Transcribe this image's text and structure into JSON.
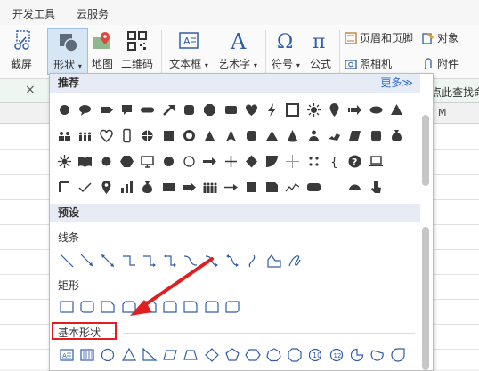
{
  "menu_tabs": [
    "开发工具",
    "云服务"
  ],
  "ribbon": {
    "screenshot_label": "截屏",
    "shape_label": "形状",
    "map_label": "地图",
    "qrcode_label": "二维码",
    "textbox_label": "文本框",
    "wordart_label": "艺术字",
    "symbol_label": "符号",
    "formula_label": "公式",
    "header_footer_label": "页眉和页脚",
    "object_label": "对象",
    "camera_label": "照相机",
    "attachment_label": "附件"
  },
  "formula_bar": {
    "close_glyph": "×",
    "right_text": "点此查找命"
  },
  "column_header_right": "M",
  "panel": {
    "recommended_title": "推荐",
    "more_link": "更多≫",
    "preset_title": "预设",
    "lines_title": "线条",
    "rect_title": "矩形",
    "basic_title": "基本形状"
  },
  "colors": {
    "accent_blue": "#2f5ea8",
    "shape_dark": "#3a3a3a",
    "highlight_red": "#e02020"
  }
}
